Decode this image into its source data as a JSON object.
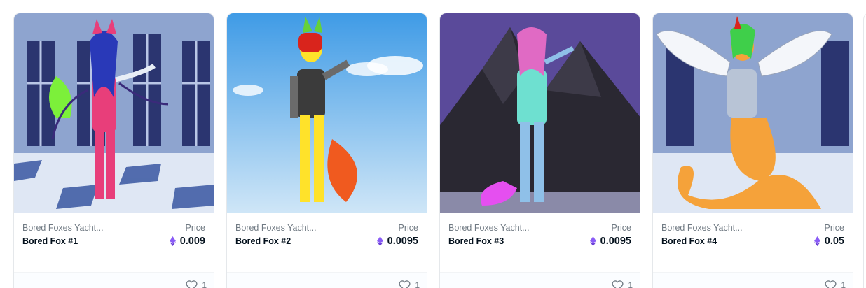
{
  "cards": [
    {
      "collection": "Bored Foxes Yacht...",
      "name": "Bored Fox #1",
      "price_label": "Price",
      "price": "0.009",
      "likes": "1",
      "currency_icon": "ethereum-icon"
    },
    {
      "collection": "Bored Foxes Yacht...",
      "name": "Bored Fox #2",
      "price_label": "Price",
      "price": "0.0095",
      "likes": "1",
      "currency_icon": "ethereum-icon"
    },
    {
      "collection": "Bored Foxes Yacht...",
      "name": "Bored Fox #3",
      "price_label": "Price",
      "price": "0.0095",
      "likes": "1",
      "currency_icon": "ethereum-icon"
    },
    {
      "collection": "Bored Foxes Yacht...",
      "name": "Bored Fox #4",
      "price_label": "Price",
      "price": "0.05",
      "likes": "1",
      "currency_icon": "ethereum-icon"
    }
  ],
  "colors": {
    "eth_purple": "#8a5cf6",
    "text_primary": "#04111d",
    "text_secondary": "#707a83"
  }
}
